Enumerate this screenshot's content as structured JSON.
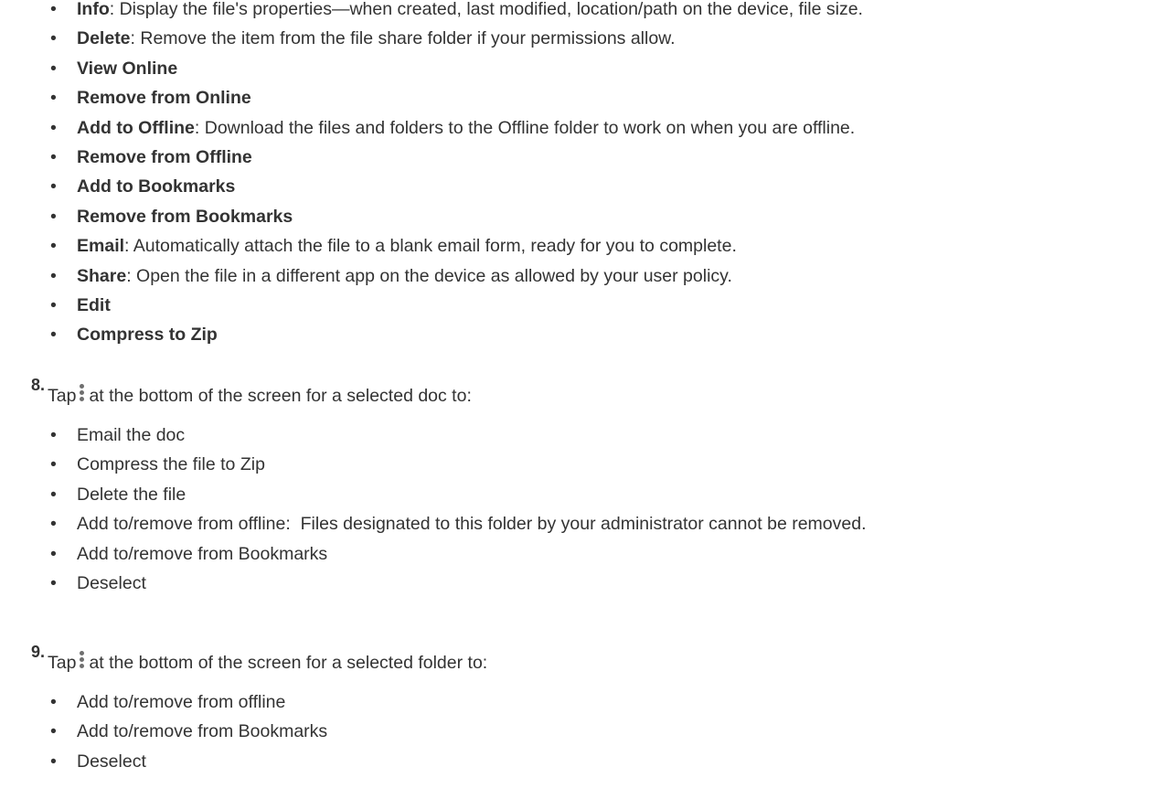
{
  "bullet_glyph": "•",
  "menu_items": [
    {
      "term": "Info",
      "desc": ": Display the file's properties—when created, last modified, location/path on the device, file size."
    },
    {
      "term": "Delete",
      "desc": ": Remove the item from the file share folder if your permissions allow."
    },
    {
      "term": "View Online",
      "desc": ""
    },
    {
      "term": "Remove from Online",
      "desc": ""
    },
    {
      "term": "Add to Offline",
      "desc": ": Download the files and folders to the Offline folder to work on when you are offline."
    },
    {
      "term": "Remove from Offline",
      "desc": ""
    },
    {
      "term": "Add to Bookmarks",
      "desc": ""
    },
    {
      "term": "Remove from Bookmarks",
      "desc": ""
    },
    {
      "term": "Email",
      "desc": ": Automatically attach the file to a blank email form, ready for you to complete."
    },
    {
      "term": "Share",
      "desc": ": Open the file in a different app on the device as allowed by your user policy."
    },
    {
      "term": "Edit",
      "desc": ""
    },
    {
      "term": "Compress to Zip",
      "desc": ""
    }
  ],
  "step8": {
    "number": "8.",
    "text_before": "Tap",
    "icon": "kebab-menu-icon",
    "text_after": "at the bottom of the screen for a selected doc to:",
    "items": [
      "Email the doc",
      "Compress the file to Zip",
      "Delete the file",
      "Add to/remove from offline:  Files designated to this folder by your administrator cannot be removed.",
      "Add to/remove from Bookmarks",
      "Deselect"
    ]
  },
  "step9": {
    "number": "9.",
    "text_before": "Tap",
    "icon": "kebab-menu-icon",
    "text_after": "at the bottom of the screen for a selected folder to:",
    "items": [
      "Add to/remove from offline",
      "Add to/remove from Bookmarks",
      "Deselect"
    ]
  }
}
